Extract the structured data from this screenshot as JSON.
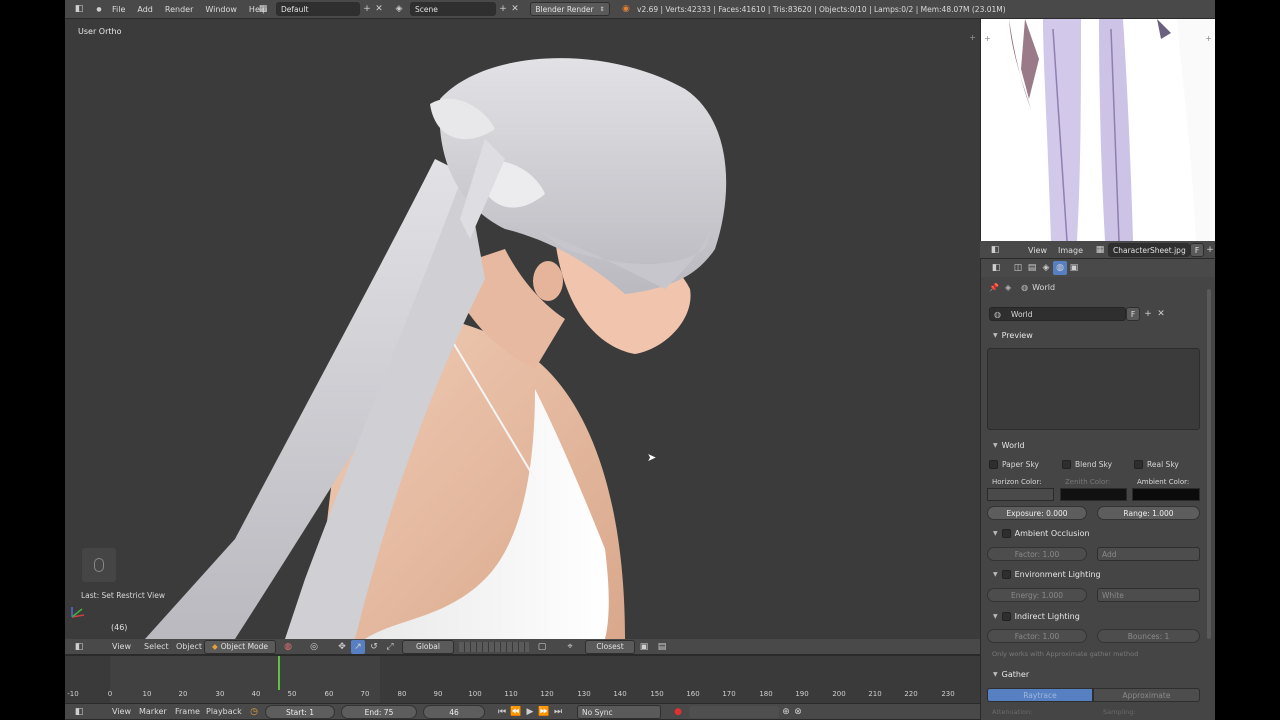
{
  "top": {
    "menus": [
      "File",
      "Add",
      "Render",
      "Window",
      "Help"
    ],
    "layout": "Default",
    "scene": "Scene",
    "engine": "Blender Render",
    "stats": "v2.69 | Verts:42333 | Faces:41610 | Tris:83620 | Objects:0/10 | Lamps:0/2 | Mem:48.07M (23.01M)"
  },
  "viewport": {
    "label": "User Ortho",
    "last_op": "Last: Set Restrict View",
    "frame_indicator": "(46)"
  },
  "view3d_header": {
    "menus": [
      "View",
      "Select",
      "Object"
    ],
    "mode": "Object Mode",
    "orientation": "Global",
    "snap": "Closest"
  },
  "timeline": {
    "ticks": [
      "-10",
      "0",
      "10",
      "20",
      "30",
      "40",
      "50",
      "60",
      "70",
      "80",
      "90",
      "100",
      "110",
      "120",
      "130",
      "140",
      "150",
      "160",
      "170",
      "180",
      "190",
      "200",
      "210",
      "220",
      "230"
    ],
    "menus": [
      "View",
      "Marker",
      "Frame",
      "Playback"
    ],
    "start": "Start: 1",
    "end": "End: 75",
    "current": "46",
    "sync": "No Sync",
    "current_frame": 46
  },
  "image_editor": {
    "menus": [
      "View",
      "Image"
    ],
    "image_name": "CharacterSheet.jpg",
    "fake_user": "F"
  },
  "properties": {
    "breadcrumb": "World",
    "datablock": "World",
    "fake_user": "F",
    "preview_label": "Preview",
    "world_label": "World",
    "checks": [
      "Paper Sky",
      "Blend Sky",
      "Real Sky"
    ],
    "colors": {
      "horizon_label": "Horizon Color:",
      "zenith_label": "Zenith Color:",
      "ambient_label": "Ambient Color:",
      "horizon": "#4a4a4a",
      "zenith": "#111111",
      "ambient": "#0b0b0b"
    },
    "exposure": "Exposure: 0.000",
    "range": "Range: 1.000",
    "ao": {
      "label": "Ambient Occlusion",
      "factor": "Factor: 1.00",
      "blend": "Add"
    },
    "env": {
      "label": "Environment Lighting",
      "energy": "Energy: 1.000",
      "color": "White"
    },
    "indirect": {
      "label": "Indirect Lighting",
      "factor": "Factor: 1.00",
      "bounces": "Bounces: 1",
      "note": "Only works with Approximate gather method"
    },
    "gather": {
      "label": "Gather",
      "raytrace": "Raytrace",
      "approximate": "Approximate",
      "attenuation": "Attenuation:",
      "sampling": "Sampling:"
    }
  }
}
